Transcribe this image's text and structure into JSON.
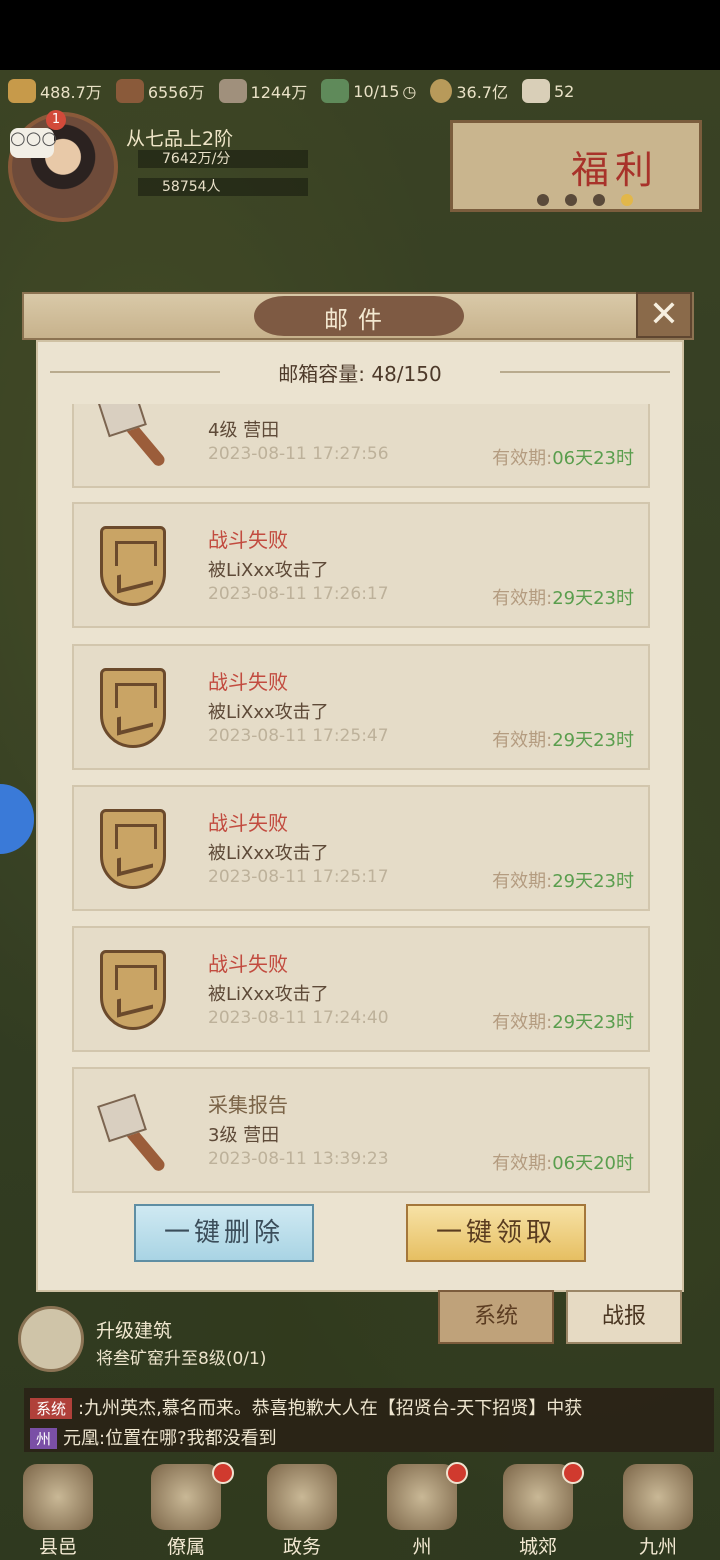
{
  "resources": [
    {
      "name": "wheat-icon",
      "value": "488.7万",
      "color": "#c79a4a"
    },
    {
      "name": "wood-icon",
      "value": "6556万",
      "color": "#8a5a3a"
    },
    {
      "name": "stone-icon",
      "value": "1244万",
      "color": "#a0907c"
    },
    {
      "name": "soldier-icon",
      "value": "10/15",
      "color": "#5f8a5a"
    },
    {
      "name": "coin-icon",
      "value": "36.7亿",
      "color": "#b89a5a"
    },
    {
      "name": "ingot-icon",
      "value": "52",
      "color": "#d9cfb8"
    }
  ],
  "player": {
    "notification_count": "1",
    "chat_bubble": "○○○",
    "rank": "从七品上2阶",
    "income": "7642万/分",
    "population": "58754人"
  },
  "fuli": {
    "title": "福利"
  },
  "dialog": {
    "title": "邮件",
    "capacity": "邮箱容量: 48/150",
    "close": "✕"
  },
  "mails": [
    {
      "icon": "axe-icon",
      "title": "",
      "sub": "4级  营田",
      "time": "2023-08-11  17:27:56",
      "valid_label": "有效期:",
      "valid_value": "06天23时",
      "type": "plain"
    },
    {
      "icon": "shield-icon",
      "title": "战斗失败",
      "sub": "被LiXxx攻击了",
      "time": "2023-08-11  17:26:17",
      "valid_label": "有效期:",
      "valid_value": "29天23时",
      "type": "battle"
    },
    {
      "icon": "shield-icon",
      "title": "战斗失败",
      "sub": "被LiXxx攻击了",
      "time": "2023-08-11  17:25:47",
      "valid_label": "有效期:",
      "valid_value": "29天23时",
      "type": "battle"
    },
    {
      "icon": "shield-icon",
      "title": "战斗失败",
      "sub": "被LiXxx攻击了",
      "time": "2023-08-11  17:25:17",
      "valid_label": "有效期:",
      "valid_value": "29天23时",
      "type": "battle"
    },
    {
      "icon": "shield-icon",
      "title": "战斗失败",
      "sub": "被LiXxx攻击了",
      "time": "2023-08-11  17:24:40",
      "valid_label": "有效期:",
      "valid_value": "29天23时",
      "type": "battle"
    },
    {
      "icon": "axe-icon",
      "title": "采集报告",
      "sub": "3级  营田",
      "time": "2023-08-11  13:39:23",
      "valid_label": "有效期:",
      "valid_value": "06天20时",
      "type": "plain"
    }
  ],
  "buttons": {
    "delete_all": "一键删除",
    "claim_all": "一键领取"
  },
  "tabs": {
    "system": "系统",
    "battle": "战报"
  },
  "task": {
    "title": "升级建筑",
    "desc": "将叁矿窑升至8级(0/1)"
  },
  "chat": {
    "line1_tag": "系统",
    "line1": ":九州英杰,慕名而来。恭喜抱歉大人在【招贤台-天下招贤】中获",
    "line2_tag": "州",
    "line2": "元凰:位置在哪?我都没看到"
  },
  "nav": [
    {
      "label": "县邑",
      "icon": "city-icon"
    },
    {
      "label": "僚属",
      "icon": "officials-icon"
    },
    {
      "label": "政务",
      "icon": "affairs-icon"
    },
    {
      "label": "州",
      "icon": "state-icon"
    },
    {
      "label": "城郊",
      "icon": "suburb-icon"
    },
    {
      "label": "九州",
      "icon": "map-icon"
    }
  ],
  "colors": {
    "battle_title": "#c24b3f",
    "valid_green": "#5a9e4e",
    "accent_gold": "#e6bf62",
    "accent_blue": "#a9d4e4"
  }
}
